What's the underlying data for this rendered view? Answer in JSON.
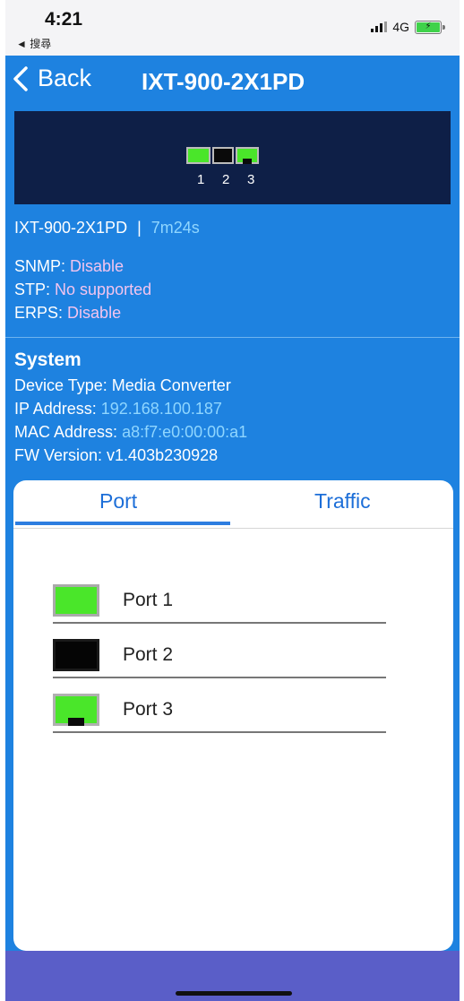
{
  "status_bar": {
    "time": "4:21",
    "back_to_app": "◄ 搜尋",
    "network": "4G",
    "battery_icon": "battery-charging-icon"
  },
  "nav": {
    "back_label": "Back",
    "title": "IXT-900-2X1PD"
  },
  "panel": {
    "port_numbers": [
      "1",
      "2",
      "3"
    ]
  },
  "device": {
    "name": "IXT-900-2X1PD",
    "separator": "|",
    "uptime": "7m24s",
    "snmp_label": "SNMP:",
    "snmp_value": "Disable",
    "stp_label": "STP:",
    "stp_value": "No supported",
    "erps_label": "ERPS:",
    "erps_value": "Disable"
  },
  "system": {
    "title": "System",
    "device_type_label": "Device Type:",
    "device_type_value": "Media Converter",
    "ip_label": "IP Address:",
    "ip_value": "192.168.100.187",
    "mac_label": "MAC Address:",
    "mac_value": "a8:f7:e0:00:00:a1",
    "fw_label": "FW Version:",
    "fw_value": "v1.403b230928"
  },
  "tabs": {
    "port": "Port",
    "traffic": "Traffic",
    "active": "Port"
  },
  "ports": [
    {
      "label": "Port 1",
      "status": "link-up",
      "color": "#4ae62a"
    },
    {
      "label": "Port 2",
      "status": "link-down",
      "color": "#050505"
    },
    {
      "label": "Port 3",
      "status": "link-up-fiber",
      "color": "#4ae62a"
    }
  ],
  "colors": {
    "primary_blue": "#1e82e0",
    "panel_navy": "#0e1f47",
    "accent_light": "#8fd6ff",
    "accent_pink": "#f2c4ee",
    "bottom_band": "#5a5ec8"
  }
}
